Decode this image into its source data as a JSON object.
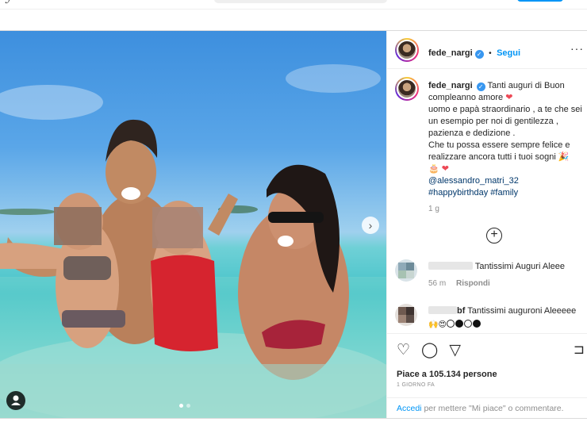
{
  "post": {
    "author": "fede_nargi",
    "follow_sep": "•",
    "follow_label": "Segui",
    "more_label": "···",
    "caption_lines": [
      "Tanti auguri di Buon compleanno amore",
      "uomo e papà straordinario , a te che sei un esempio per noi di gentilezza , pazienza e dedizione .",
      "Che tu possa essere sempre felice e realizzare ancora tutti i tuoi sogni"
    ],
    "mention": "@alessandro_matri_32",
    "hashtags": "#happybirthday #family",
    "caption_age": "1 g",
    "load_more": "+",
    "next_arrow": "›"
  },
  "comments": [
    {
      "text": "Tantissimi Auguri Aleee",
      "age": "56 m",
      "reply": "Rispondi"
    },
    {
      "name_suffix": "bf",
      "text": "Tantissimi auguroni Aleeeee"
    }
  ],
  "actions": {
    "like_icon": "♡",
    "comment_icon": "◯",
    "share_icon": "▽",
    "save_icon": "⊐",
    "likes_text": "Piace a 105.134 persone",
    "time_ago": "1 GIORNO FA",
    "login_link": "Accedi",
    "login_text": "per mettere \"Mi piace\" o commentare."
  },
  "colors": {
    "accent": "#0095f6",
    "verified": "#3897f0",
    "heart": "#ed4956"
  }
}
